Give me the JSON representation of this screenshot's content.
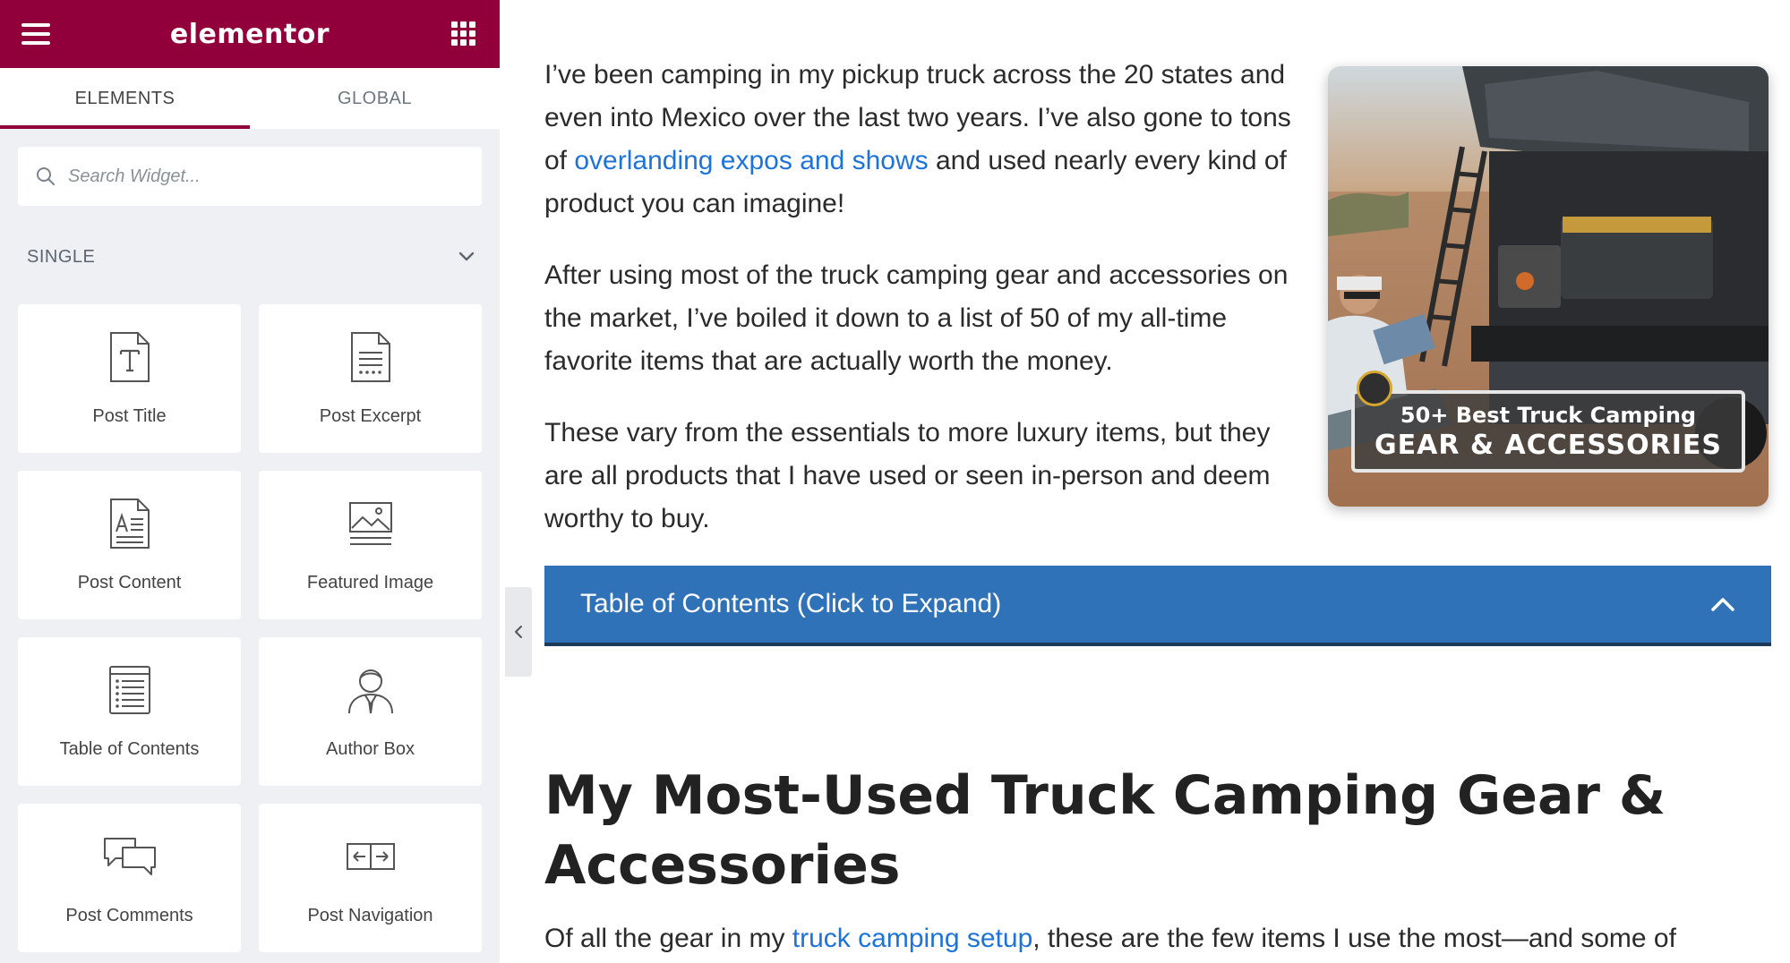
{
  "sidebar": {
    "brand": "elementor",
    "tabs": [
      {
        "label": "ELEMENTS"
      },
      {
        "label": "GLOBAL"
      }
    ],
    "search": {
      "placeholder": "Search Widget..."
    },
    "section": {
      "label": "SINGLE"
    },
    "widgets": [
      {
        "label": "Post Title",
        "icon": "post-title-icon"
      },
      {
        "label": "Post Excerpt",
        "icon": "post-excerpt-icon"
      },
      {
        "label": "Post Content",
        "icon": "post-content-icon"
      },
      {
        "label": "Featured Image",
        "icon": "featured-image-icon"
      },
      {
        "label": "Table of Contents",
        "icon": "table-of-contents-icon"
      },
      {
        "label": "Author Box",
        "icon": "author-box-icon"
      },
      {
        "label": "Post Comments",
        "icon": "post-comments-icon"
      },
      {
        "label": "Post Navigation",
        "icon": "post-navigation-icon"
      }
    ],
    "accent": "#92003b"
  },
  "article": {
    "p1": {
      "before": "I’ve been camping in my pickup truck across the 20 states and even into Mexico over the last two years. I’ve also gone to tons of ",
      "link": "overlanding expos and shows",
      "after": " and used nearly every kind of product you can imagine!"
    },
    "p2": "After using most of the truck camping gear and accessories on the market, I’ve boiled it down to a list of 50 of my all-time favorite items that are actually worth the money.",
    "p3": "These vary from the essentials to more luxury items, but they are all products that I have used or seen in-person and deem worthy to buy.",
    "hero": {
      "line1": "50+ Best Truck Camping",
      "line2": "GEAR & ACCESSORIES"
    },
    "toc": {
      "label": "Table of Contents (Click to Expand)"
    },
    "heading": "My Most-Used Truck Camping Gear & Accessories",
    "bottom": {
      "before": "Of all the gear in my ",
      "link": "truck camping setup",
      "after": ", these are the few items I use the most—and some of"
    },
    "link_color": "#1e73d8",
    "toc_color": "#2f72b7"
  }
}
